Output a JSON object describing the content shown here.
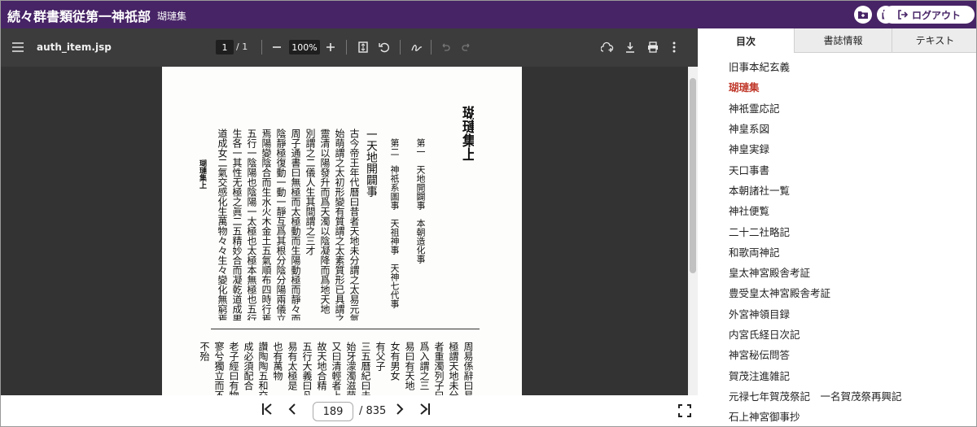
{
  "header": {
    "app_title": "続々群書類従第一神祇部",
    "doc_title": "瑚璉集",
    "logout_label": "ログアウト"
  },
  "viewer": {
    "filename": "auth_item.jsp",
    "page_current": "1",
    "page_total": "/ 1",
    "zoom": "100%",
    "nav_page": "189",
    "nav_total": "/ 835"
  },
  "document": {
    "running_head": "瑚璉集上",
    "columns": [
      "瑚璉集上",
      "第一　天地開闢事　本朝造化事",
      "第二　神祇系圖事　天祖神事　天神七代事",
      "一天地開闢事",
      "古今帝王年代曆曰昔者天地未分謂之太易元氣",
      "始萌謂之太初形變有質謂之太素質形已具謂之太極五氣運通爲天地之二",
      "靈清以陽發升而爲天濁以陰凝降而爲地天地",
      "別謂之二儀人生其間謂之三才",
      "周子通書曰無極而太極動而生陽動極而靜々而生",
      "陰靜極復動一動一靜互爲其根分陰分陽兩儀立",
      "焉陽變陰合而生水火木金土五氣順布四時行焉",
      "五行一陰陽也陰陽一太極也太極本無極也五行之",
      "生各一其性无極之眞二五精妙合而凝乾道成男坤",
      "道成女二氣交感化生萬物々々生々變化無窮焉"
    ],
    "lower_columns": [
      "周易係辭曰易",
      "極謂天地未分",
      "者重濁列子曰",
      "爲入謂之三",
      "易曰有天地",
      "女有男女",
      "有父子",
      "三五曆紀曰未",
      "始牙濛濁滋萌",
      "又曰清輕者上",
      "故天地合精",
      "五行大義曰凡",
      "易有太極是",
      "也有萬物",
      "讚陶陶五和交",
      "成必須配合",
      "老子經曰有物",
      "寥兮獨立而不",
      "不殆"
    ]
  },
  "side": {
    "tabs": [
      "目次",
      "書誌情報",
      "テキスト"
    ],
    "active_tab": "目次",
    "toc": [
      "旧事本紀玄義",
      "瑚璉集",
      "神祇霊応記",
      "神皇系図",
      "神皇実録",
      "天口事書",
      "本朝諸社一覧",
      "神社便覧",
      "二十二社略記",
      "和歌両神記",
      "皇太神宮殿舎考証",
      "豊受皇太神宮殿舎考証",
      "外宮神領目録",
      "内宮氏経日次記",
      "神宮秘伝問答",
      "賀茂注進雑記",
      "元禄七年賀茂祭記　一名賀茂祭再興記",
      "石上神宮御事抄"
    ],
    "current_item": "瑚璉集"
  },
  "colors": {
    "header_bg": "#472466",
    "toolbar_bg": "#3c3c3c",
    "current_toc": "#c0392b"
  }
}
